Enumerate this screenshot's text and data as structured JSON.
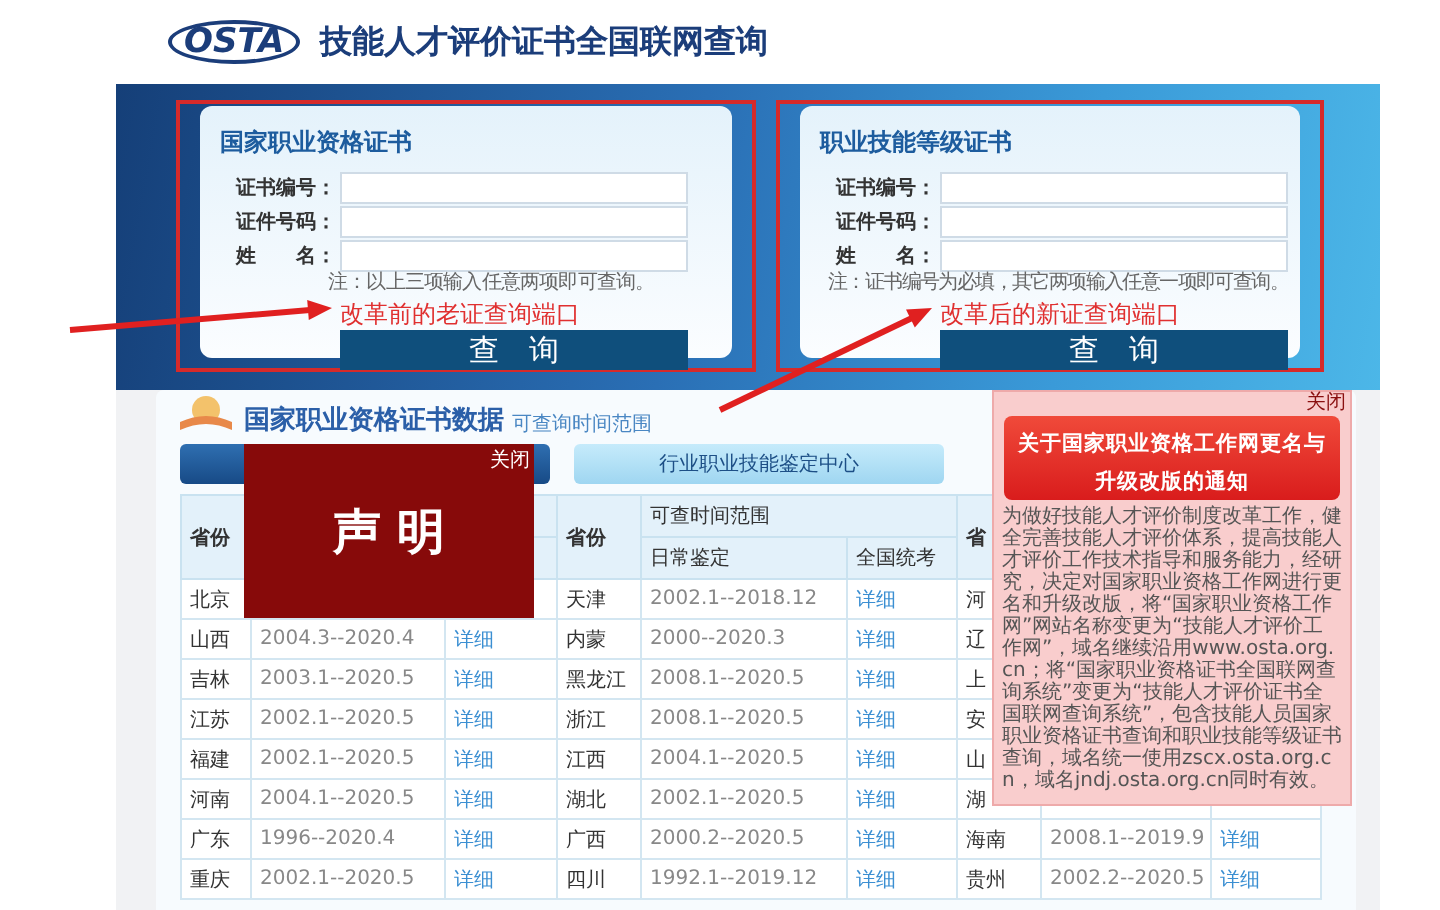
{
  "header": {
    "logo": "OSTA",
    "title": "技能人才评价证书全国联网查询"
  },
  "query_panels": [
    {
      "title": "国家职业资格证书",
      "fields": [
        {
          "label": "证书编号："
        },
        {
          "label": "证件号码："
        },
        {
          "label": "姓　　名："
        }
      ],
      "note": "注：以上三项输入任意两项即可查询。",
      "button": "查　询",
      "annotation": "改革前的老证查询端口"
    },
    {
      "title": "职业技能等级证书",
      "fields": [
        {
          "label": "证书编号："
        },
        {
          "label": "证件号码："
        },
        {
          "label": "姓　　名："
        }
      ],
      "note": "注：证书编号为必填，其它两项输入任意一项即可查询。",
      "button": "查　询",
      "annotation": "改革后的新证查询端口"
    }
  ],
  "data_panel": {
    "title": "国家职业资格证书数据",
    "subtitle": "可查询时间范围",
    "tabs": [
      {
        "selected": true
      },
      {
        "label": "行业职业技能鉴定中心",
        "selected": false
      }
    ],
    "table": {
      "header": [
        {
          "province": "省份"
        },
        {
          "province": "省份",
          "range": "可查时间范围",
          "daily": "日常鉴定",
          "national": "全国统考"
        },
        {
          "province": "省"
        }
      ],
      "rows": [
        {
          "groups": [
            {
              "province": "北京"
            },
            {
              "province": "天津",
              "daily": "2002.1--2018.12",
              "link": "详细"
            },
            {
              "province": "河"
            }
          ]
        },
        {
          "groups": [
            {
              "province": "山西",
              "daily": "2004.3--2020.4",
              "link": "详细"
            },
            {
              "province": "内蒙",
              "daily": "2000--2020.3",
              "link": "详细"
            },
            {
              "province": "辽"
            }
          ]
        },
        {
          "groups": [
            {
              "province": "吉林",
              "daily": "2003.1--2020.5",
              "link": "详细"
            },
            {
              "province": "黑龙江",
              "daily": "2008.1--2020.5",
              "link": "详细"
            },
            {
              "province": "上"
            }
          ]
        },
        {
          "groups": [
            {
              "province": "江苏",
              "daily": "2002.1--2020.5",
              "link": "详细"
            },
            {
              "province": "浙江",
              "daily": "2008.1--2020.5",
              "link": "详细"
            },
            {
              "province": "安"
            }
          ]
        },
        {
          "groups": [
            {
              "province": "福建",
              "daily": "2002.1--2020.5",
              "link": "详细"
            },
            {
              "province": "江西",
              "daily": "2004.1--2020.5",
              "link": "详细"
            },
            {
              "province": "山"
            }
          ]
        },
        {
          "groups": [
            {
              "province": "河南",
              "daily": "2004.1--2020.5",
              "link": "详细"
            },
            {
              "province": "湖北",
              "daily": "2002.1--2020.5",
              "link": "详细"
            },
            {
              "province": "湖"
            }
          ]
        },
        {
          "groups": [
            {
              "province": "广东",
              "daily": "1996--2020.4",
              "link": "详细"
            },
            {
              "province": "广西",
              "daily": "2000.2--2020.5",
              "link": "详细"
            },
            {
              "province": "海南",
              "daily": "2008.1--2019.9",
              "link": "详细"
            }
          ]
        },
        {
          "groups": [
            {
              "province": "重庆",
              "daily": "2002.1--2020.5",
              "link": "详细"
            },
            {
              "province": "四川",
              "daily": "1992.1--2019.12",
              "link": "详细"
            },
            {
              "province": "贵州",
              "daily": "2002.2--2020.5",
              "link": "详细"
            }
          ]
        }
      ]
    }
  },
  "statement_popup": {
    "title": "声 明",
    "close": "关闭"
  },
  "notice_popup": {
    "title": "关于国家职业资格工作网更名与升级改版的通知",
    "close": "关闭",
    "body": "为做好技能人才评价制度改革工作，健全完善技能人才评价体系，提高技能人才评价工作技术指导和服务能力，经研究，决定对国家职业资格工作网进行更名和升级改版，将“国家职业资格工作网”网站名称变更为“技能人才评价工作网”，域名继续沿用www.osta.org.cn；将“国家职业资格证书全国联网查询系统”变更为“技能人才评价证书全国联网查询系统”，包含技能人员国家职业资格证书查询和职业技能等级证书查询，域名统一使用zscx.osta.org.cn，域名jndj.osta.org.cn同时有效。"
  }
}
